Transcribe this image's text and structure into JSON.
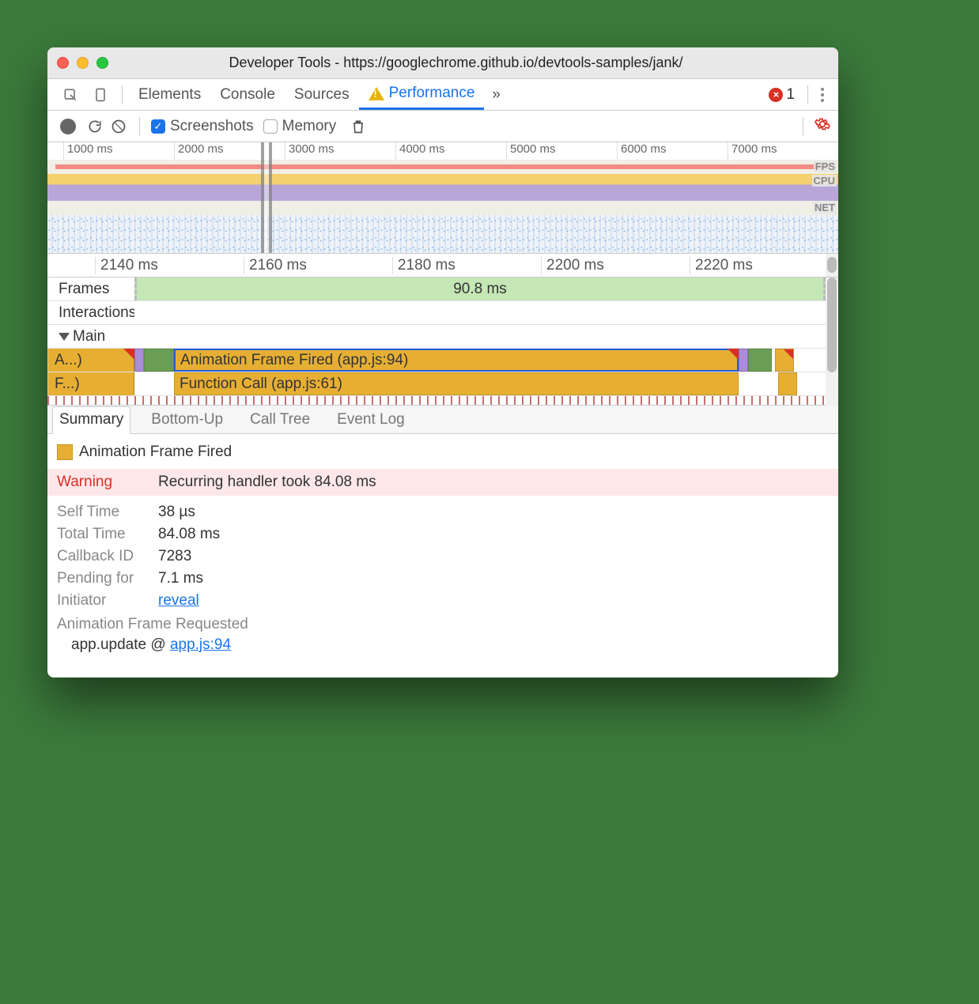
{
  "window": {
    "title": "Developer Tools - https://googlechrome.github.io/devtools-samples/jank/"
  },
  "tabs": {
    "elements": "Elements",
    "console": "Console",
    "sources": "Sources",
    "performance": "Performance",
    "more": "»",
    "error_count": "1"
  },
  "controls": {
    "screenshots": "Screenshots",
    "memory": "Memory"
  },
  "overview_ruler": [
    "1000 ms",
    "2000 ms",
    "3000 ms",
    "4000 ms",
    "5000 ms",
    "6000 ms",
    "7000 ms"
  ],
  "overview_labels": {
    "fps": "FPS",
    "cpu": "CPU",
    "net": "NET"
  },
  "flame_ruler": [
    "2140 ms",
    "2160 ms",
    "2180 ms",
    "2200 ms",
    "2220 ms"
  ],
  "tracks": {
    "frames": "Frames",
    "frames_value": "90.8 ms",
    "interactions": "Interactions",
    "main": "Main"
  },
  "flame": {
    "stub_a": "A...)",
    "stub_f": "F...)",
    "af_fired": "Animation Frame Fired (app.js:94)",
    "fn_call": "Function Call (app.js:61)"
  },
  "detail_tabs": {
    "summary": "Summary",
    "bottomup": "Bottom-Up",
    "calltree": "Call Tree",
    "eventlog": "Event Log"
  },
  "details": {
    "event_name": "Animation Frame Fired",
    "warning_label": "Warning",
    "warning_text": "Recurring handler took 84.08 ms",
    "self_time_k": "Self Time",
    "self_time_v": "38 µs",
    "total_time_k": "Total Time",
    "total_time_v": "84.08 ms",
    "callback_id_k": "Callback ID",
    "callback_id_v": "7283",
    "pending_k": "Pending for",
    "pending_v": "7.1 ms",
    "initiator_k": "Initiator",
    "initiator_v": "reveal",
    "arf": "Animation Frame Requested",
    "stack_func": "app.update @ ",
    "stack_link": "app.js:94"
  }
}
